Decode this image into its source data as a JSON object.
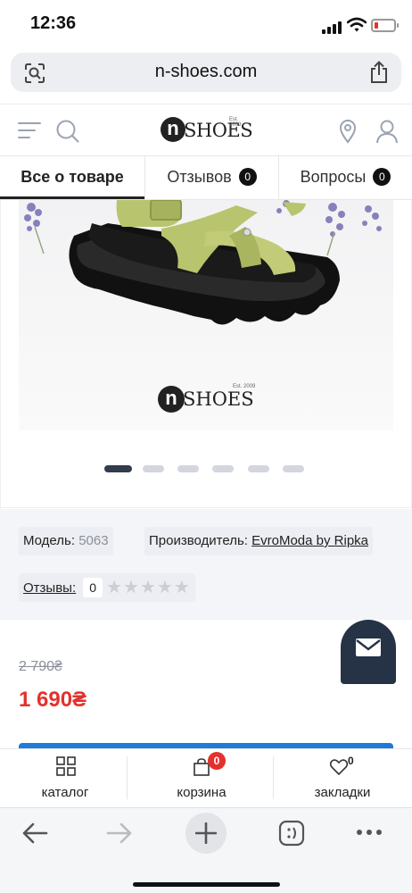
{
  "status_bar": {
    "time": "12:36"
  },
  "browser": {
    "url": "n-shoes.com",
    "icons": {
      "lens": "visual-search-icon",
      "share": "share-icon"
    }
  },
  "site_header": {
    "logo": {
      "letter": "n",
      "word": "SHOES",
      "est": "Est. 2009"
    },
    "icons": [
      "menu-icon",
      "search-icon",
      "location-pin-icon",
      "user-icon"
    ]
  },
  "tabs": [
    {
      "label": "Все о товаре",
      "active": true
    },
    {
      "label": "Отзывов",
      "count": "0"
    },
    {
      "label": "Вопросы",
      "count": "0"
    }
  ],
  "gallery": {
    "image_logo": {
      "letter": "n",
      "word": "SHOES",
      "est": "Est. 2009"
    },
    "slides_total": 6,
    "active_slide": 1
  },
  "product": {
    "model_label": "Модель:",
    "model_value": "5063",
    "maker_label": "Производитель:",
    "maker_value": "EvroModa by Ripka",
    "reviews_label": "Отзывы:",
    "reviews_count": "0",
    "rating_stars": "★★★★★",
    "rating": 0
  },
  "price": {
    "old": "2 790₴",
    "new": "1 690₴"
  },
  "bottom_nav": {
    "catalog": "каталог",
    "cart": "корзина",
    "cart_count": "0",
    "bookmarks": "закладки",
    "bookmarks_count": "0"
  },
  "colors": {
    "accent_red": "#e3312d",
    "dark": "#263245",
    "sandal": "#b9c46e",
    "link_blue": "#1f7bd8"
  }
}
